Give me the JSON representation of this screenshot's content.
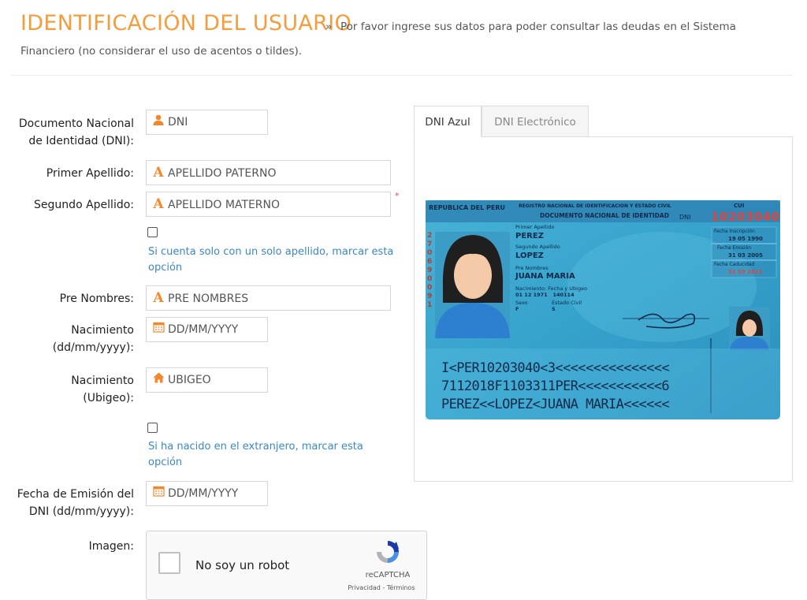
{
  "header": {
    "title": "IDENTIFICACIÓN DEL USUARIO",
    "separator": "»",
    "subtitle_line1": "Por favor ingrese sus datos para poder consultar las deudas en el Sistema",
    "subtitle_line2": "Financiero (no considerar el uso de acentos o tildes)."
  },
  "form": {
    "dni_label_1": "Documento Nacional",
    "dni_label_2": "de Identidad (DNI):",
    "dni_placeholder": "DNI",
    "apellido1_label": "Primer Apellido:",
    "apellido1_placeholder": "APELLIDO PATERNO",
    "apellido2_label": "Segundo Apellido:",
    "apellido2_placeholder": "APELLIDO MATERNO",
    "required_mark": "*",
    "solo_apellido_help_1": "Si cuenta solo con un solo apellido, marcar esta",
    "solo_apellido_help_2": "opción",
    "nombres_label": "Pre Nombres:",
    "nombres_placeholder": "PRE NOMBRES",
    "nacimiento_fecha_label_1": "Nacimiento",
    "nacimiento_fecha_label_2": "(dd/mm/yyyy):",
    "nacimiento_fecha_placeholder": "DD/MM/YYYY",
    "ubigeo_label_1": "Nacimiento",
    "ubigeo_label_2": "(Ubigeo):",
    "ubigeo_placeholder": "UBIGEO",
    "extranjero_help_1": "Si ha nacido en el extranjero, marcar esta",
    "extranjero_help_2": "opción",
    "emision_label_1": "Fecha de Emisión del",
    "emision_label_2": "DNI (dd/mm/yyyy):",
    "emision_placeholder": "DD/MM/YYYY",
    "imagen_label": "Imagen:"
  },
  "recaptcha": {
    "checkbox_label": "No soy un robot",
    "brand": "reCAPTCHA",
    "links": "Privacidad - Términos"
  },
  "tabs": [
    {
      "label": "DNI Azul",
      "active": true
    },
    {
      "label": "DNI Electrónico",
      "active": false
    }
  ],
  "dni_card": {
    "header_left": "REPUBLICA DEL PERU",
    "header_mid": "REGISTRO NACIONAL DE IDENTIFICACION Y ESTADO CIVIL",
    "doc_title": "DOCUMENTO NACIONAL DE IDENTIDAD",
    "dni_tag": "DNI",
    "cui_label": "CUI",
    "number": "10203040",
    "primer_apellido_label": "Primer Apellido",
    "primer_apellido": "PEREZ",
    "segundo_apellido_label": "Segundo Apellido",
    "segundo_apellido": "LOPEZ",
    "pre_nombres_label": "Pre Nombres",
    "pre_nombres": "JUANA MARIA",
    "nacimiento_label": "Nacimiento: Fecha y Ubigeo",
    "nacimiento_value": "01 12 1971   140114",
    "sexo_label": "Sexo",
    "sexo_value": "F",
    "estado_civil_label": "Estado Civil",
    "estado_civil_value": "S",
    "inscripcion_label": "Fecha Inscripción",
    "inscripcion_value": "19 05 1990",
    "emision_label": "Fecha Emisión",
    "emision_value": "31 03 2005",
    "caducidad_label": "Fecha Caducidad",
    "caducidad_value": "31 03 2011",
    "mrz_1": "I<PER10203040<3<<<<<<<<<<<<<<<",
    "mrz_2": "7112018F1103311PER<<<<<<<<<<<6",
    "mrz_3": "PEREZ<<LOPEZ<JUANA MARIA<<<<<<",
    "side_digits": "2 7 0 6 9 0 0 9 1"
  },
  "colors": {
    "accent_orange": "#f59d3d",
    "link_blue": "#3a88c7",
    "card_blue": "#3aa7cf"
  }
}
